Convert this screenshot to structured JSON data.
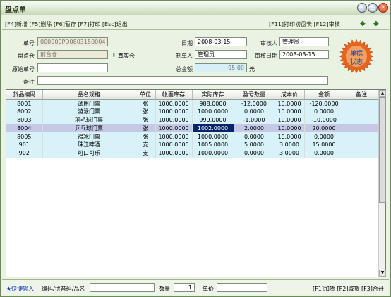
{
  "window": {
    "title": "盘点单"
  },
  "toolbar": {
    "left_text": "[F4]新增 [F5]删除 [F6]暂存 [F7]打印 [Esc]退出",
    "right_text": "[F11]打印初盘表 [F12]审核",
    "prev_icon": "arrow-left-icon",
    "next_icon": "arrow-right-icon"
  },
  "form": {
    "order_no_label": "单号",
    "order_no": "000000PD0803150004",
    "date_label": "日期",
    "date": "2008-03-15",
    "auditor_label": "审核人",
    "auditor": "管理员",
    "warehouse_label": "盘点仓",
    "warehouse": "前台仓",
    "warehouse_button": "真实仓",
    "maker_label": "制单人",
    "maker": "管理员",
    "audit_date_label": "审核日期",
    "audit_date": "2008-03-15",
    "orig_no_label": "原始单号",
    "orig_no": "",
    "total_label": "总金额",
    "total": "-95.00",
    "total_unit": "元",
    "remark_label": "备注",
    "remark": ""
  },
  "stamp": {
    "line1": "单据",
    "line2": "状态",
    "color": "#e8641c"
  },
  "table": {
    "columns": [
      "货品编码",
      "品名规格",
      "单位",
      "帐面库存",
      "实际库存",
      "盈亏数量",
      "成本价",
      "金额",
      "备注"
    ],
    "rows": [
      [
        "8001",
        "试用门票",
        "张",
        "1000.0000",
        "988.0000",
        "-12.0000",
        "10.0000",
        "-120.0000",
        ""
      ],
      [
        "8002",
        "游泳门票",
        "张",
        "1000.0000",
        "1000.0000",
        "0.0000",
        "10.0000",
        "0.0000",
        ""
      ],
      [
        "8003",
        "羽毛球门票",
        "张",
        "1000.0000",
        "999.0000",
        "-1.0000",
        "10.0000",
        "-10.0000",
        ""
      ],
      [
        "8004",
        "乒乓球门票",
        "张",
        "1000.0000",
        "1002.0000",
        "2.0000",
        "10.0000",
        "20.0000",
        ""
      ],
      [
        "8005",
        "滑冰门票",
        "张",
        "1000.0000",
        "1000.0000",
        "0.0000",
        "10.0000",
        "0.0000",
        ""
      ],
      [
        "901",
        "珠江啤酒",
        "支",
        "1000.0000",
        "1005.0000",
        "5.0000",
        "3.0000",
        "15.0000",
        ""
      ],
      [
        "902",
        "可口可乐",
        "支",
        "1000.0000",
        "1000.0000",
        "0.0000",
        "3.0000",
        "0.0000",
        ""
      ]
    ]
  },
  "status": {
    "quick_input": "★快捷输入",
    "code_label": "编码/拼音码/品名",
    "code_value": "",
    "qty_label": "数量",
    "qty_value": "1",
    "price_label": "单价",
    "price_value": "",
    "keys": "[F1]加货 [F2]减货 [F3]合计"
  }
}
